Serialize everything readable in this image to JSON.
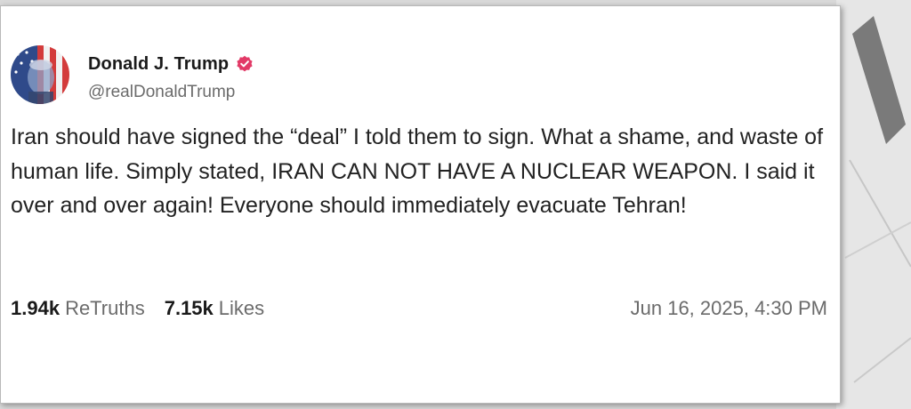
{
  "post": {
    "author_name": "Donald J. Trump",
    "handle": "@realDonaldTrump",
    "text": "Iran should have signed the “deal” I told them to sign. What a shame, and waste of human life. Simply stated, IRAN CAN NOT HAVE A NUCLEAR WEAPON. I said it over and over again! Everyone should immediately evacuate Tehran!",
    "retruths_count": "1.94k",
    "retruths_label": "ReTruths",
    "likes_count": "7.15k",
    "likes_label": "Likes",
    "timestamp": "Jun 16, 2025, 4:30 PM"
  },
  "icons": {
    "verified": "verified-badge-icon",
    "avatar": "profile-avatar"
  },
  "colors": {
    "verified_badge": "#e23a67",
    "card_background": "#ffffff",
    "muted_text": "#6b6b6b",
    "body_text": "#222222"
  }
}
